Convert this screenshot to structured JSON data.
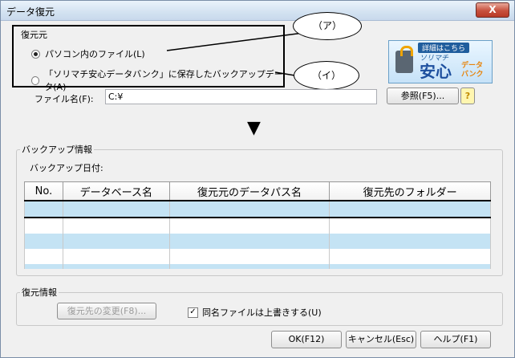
{
  "window": {
    "title": "データ復元",
    "close_glyph": "X"
  },
  "source": {
    "legend": "復元元",
    "option_pc": "パソコン内のファイル(L)",
    "option_bank": "「ソリマチ安心データバンク」に保存したバックアップデータ(A)",
    "selected": "pc"
  },
  "callouts": {
    "a": "（ア）",
    "i": "（イ）"
  },
  "banner": {
    "top": "詳細はこちら",
    "brand": "ソリマチ",
    "main": "安心",
    "sub1": "データ",
    "sub2": "バンク"
  },
  "filename": {
    "label": "ファイル名(F):",
    "value": "C:¥",
    "browse_button": "参照(F5)...",
    "help_glyph": "?"
  },
  "arrow_glyph": "▼",
  "backup_info": {
    "legend": "バックアップ情報",
    "date_label": "バックアップ日付:",
    "columns": [
      "No.",
      "データベース名",
      "復元元のデータパス名",
      "復元先のフォルダー"
    ]
  },
  "restore_info": {
    "legend": "復元情報",
    "change_dest_button": "復元先の変更(F8)...",
    "overwrite_label": "同名ファイルは上書きする(U)",
    "overwrite_checked": true,
    "check_glyph": "✓"
  },
  "footer": {
    "ok": "OK(F12)",
    "cancel": "キャンセル(Esc)",
    "help": "ヘルプ(F1)"
  }
}
